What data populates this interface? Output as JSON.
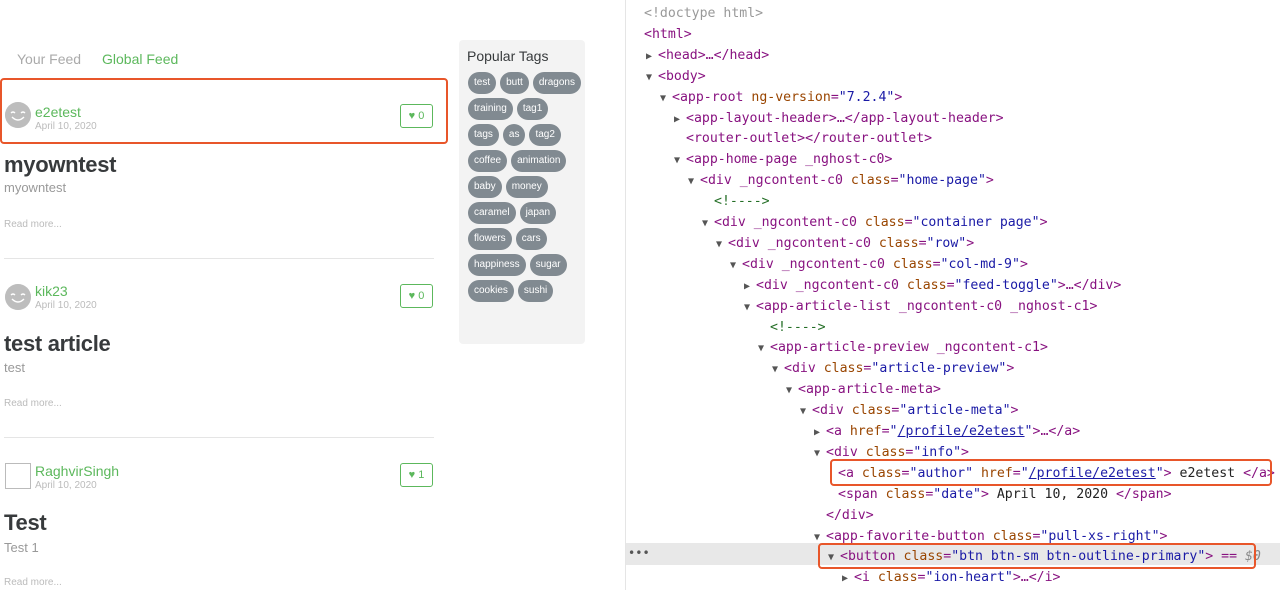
{
  "feed": {
    "tabs": [
      {
        "label": "Your Feed"
      },
      {
        "label": "Global Feed"
      }
    ],
    "articles": [
      {
        "author": "e2etest",
        "date": "April 10, 2020",
        "favorites": "0",
        "title": "myowntest",
        "description": "myowntest",
        "read_more": "Read more..."
      },
      {
        "author": "kik23",
        "date": "April 10, 2020",
        "favorites": "0",
        "title": "test article",
        "description": "test",
        "read_more": "Read more..."
      },
      {
        "author": "RaghvirSingh",
        "date": "April 10, 2020",
        "favorites": "1",
        "title": "Test",
        "description": "Test 1",
        "read_more": "Read more..."
      }
    ]
  },
  "sidebar": {
    "title": "Popular Tags",
    "tags": [
      "test",
      "butt",
      "dragons",
      "training",
      "tag1",
      "tags",
      "as",
      "tag2",
      "coffee",
      "animation",
      "baby",
      "money",
      "caramel",
      "japan",
      "flowers",
      "cars",
      "happiness",
      "sugar",
      "cookies",
      "sushi"
    ]
  },
  "devtools": {
    "lines": [
      "<!doctype html>",
      "<html>",
      "<head>…</head>",
      "<body>",
      "<app-root ng-version=\"7.2.4\">",
      "<app-layout-header>…</app-layout-header>",
      "<router-outlet></router-outlet>",
      "<app-home-page _nghost-c0>",
      "<div _ngcontent-c0 class=\"home-page\">",
      "<!---->",
      "<div _ngcontent-c0 class=\"container page\">",
      "<div _ngcontent-c0 class=\"row\">",
      "<div _ngcontent-c0 class=\"col-md-9\">",
      "<div _ngcontent-c0 class=\"feed-toggle\">…</div>",
      "<app-article-list _ngcontent-c0 _nghost-c1>",
      "<!---->",
      "<app-article-preview _ngcontent-c1>",
      "<div class=\"article-preview\">",
      "<app-article-meta>",
      "<div class=\"article-meta\">",
      "<a href=\"/profile/e2etest\">…</a>",
      "<div class=\"info\">",
      "<a class=\"author\" href=\"/profile/e2etest\"> e2etest </a>",
      "<span class=\"date\"> April 10, 2020 </span>",
      "</div>",
      "<app-favorite-button class=\"pull-xs-right\">",
      "<button class=\"btn btn-sm btn-outline-primary\"> == $0",
      "<i class=\"ion-heart\">…</i>"
    ],
    "gutter_dots": "•••"
  },
  "colors": {
    "accent": "#5cb85c",
    "highlight": "#e8562a",
    "tag_bg": "#818a91"
  }
}
